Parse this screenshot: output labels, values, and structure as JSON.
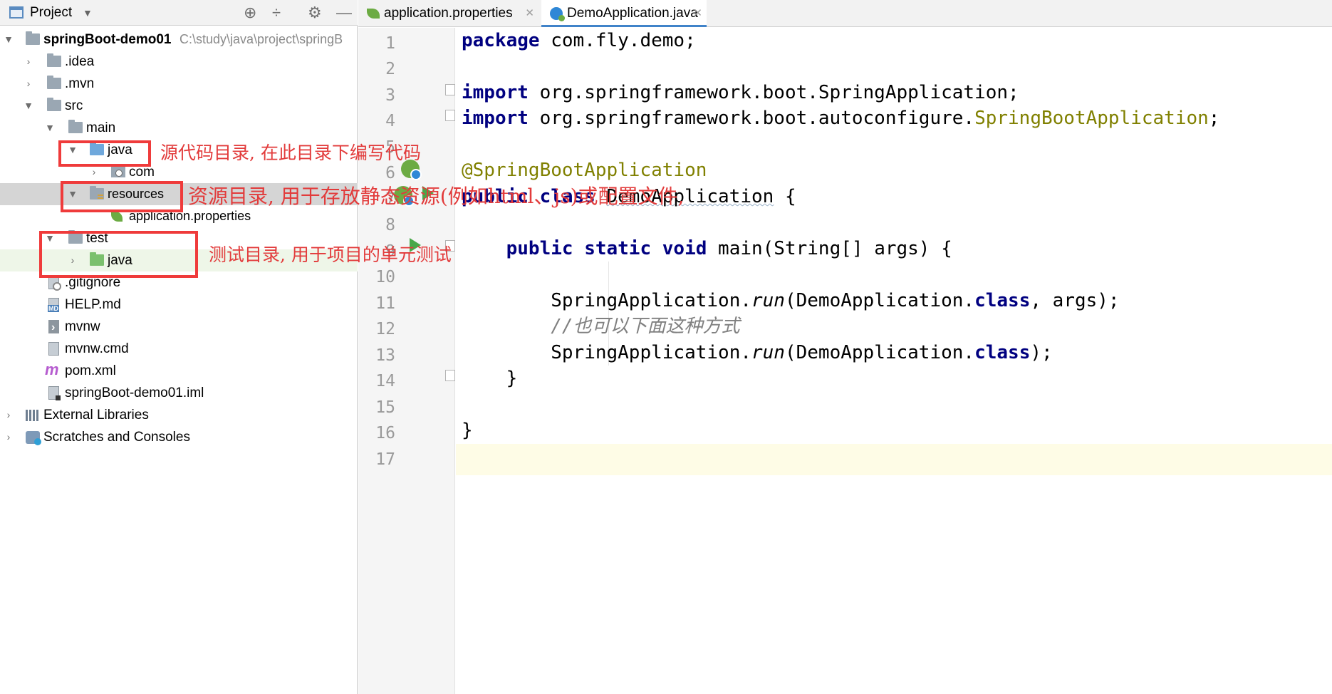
{
  "project_panel": {
    "title": "Project",
    "tools": {
      "locate": "⊕",
      "collapse": "÷",
      "settings": "⚙",
      "hide": "—"
    },
    "tree": [
      {
        "name": "springBoot-demo01",
        "hint": "C:\\study\\java\\project\\springB"
      },
      {
        "name": ".idea"
      },
      {
        "name": ".mvn"
      },
      {
        "name": "src"
      },
      {
        "name": "main"
      },
      {
        "name": "java"
      },
      {
        "name": "com"
      },
      {
        "name": "resources"
      },
      {
        "name": "application.properties"
      },
      {
        "name": "test"
      },
      {
        "name": "java"
      },
      {
        "name": ".gitignore"
      },
      {
        "name": "HELP.md"
      },
      {
        "name": "mvnw"
      },
      {
        "name": "mvnw.cmd"
      },
      {
        "name": "pom.xml"
      },
      {
        "name": "springBoot-demo01.iml"
      },
      {
        "name": "External Libraries"
      },
      {
        "name": "Scratches and Consoles"
      }
    ]
  },
  "annotations": {
    "java_note": "源代码目录, 在此目录下编写代码",
    "resources_note": "资源目录, 用于存放静态资源(例如html、js)或配置文件,",
    "test_note": "测试目录, 用于项目的单元测试",
    "color": "#ef3b3b"
  },
  "editor": {
    "tabs": [
      {
        "label": "application.properties",
        "active": false
      },
      {
        "label": "DemoApplication.java",
        "active": true
      }
    ],
    "line_numbers": [
      "1",
      "2",
      "3",
      "4",
      "5",
      "6",
      "7",
      "8",
      "9",
      "10",
      "11",
      "12",
      "13",
      "14",
      "15",
      "16",
      "17"
    ],
    "code": {
      "l1_kw": "package",
      "l1_rest": " com.fly.demo;",
      "l3_kw": "import",
      "l3_rest": " org.springframework.boot.SpringApplication;",
      "l4_kw": "import",
      "l4_rest": " org.springframework.boot.autoconfigure.",
      "l4_cls": "SpringBootApplication",
      "l4_end": ";",
      "l6_ann": "@SpringBootApplication",
      "l7_kw": "public class",
      "l7_sp": " ",
      "l7_name": "DemoApplication",
      "l7_end": " {",
      "l9_indent": "    ",
      "l9_kw": "public static void",
      "l9_rest": " main(String[] args) {",
      "l11_indent": "        ",
      "l11_pre": "SpringApplication.",
      "l11_meth": "run",
      "l11_mid": "(DemoApplication.",
      "l11_kw": "class",
      "l11_end": ", args);",
      "l12_indent": "        ",
      "l12_comment": "//也可以下面这种方式",
      "l13_indent": "        ",
      "l13_pre": "SpringApplication.",
      "l13_meth": "run",
      "l13_mid": "(DemoApplication.",
      "l13_kw": "class",
      "l13_end": ");",
      "l14_text": "    }",
      "l16_text": "}"
    }
  },
  "colors": {
    "keyword": "#000080",
    "annotation": "#808000",
    "comment": "#808080",
    "run": "#49a84a",
    "current_line": "#fefce6"
  }
}
